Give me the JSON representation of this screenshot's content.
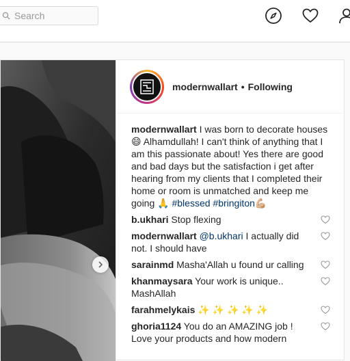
{
  "search": {
    "placeholder": "Search"
  },
  "nav": {
    "explore_icon": "compass-icon",
    "activity_icon": "heart-icon",
    "profile_icon": "person-icon"
  },
  "post": {
    "username": "modernwallart",
    "separator": "•",
    "follow_status": "Following",
    "caption": {
      "username": "modernwallart",
      "text": "I was born to decorate houses 😄 Alhamdullah! I can't think of anything that I am this passionate about! Yes there are good and bad days but the satisfaction i get after hearing from my clients that I completed their home or room is unmatched and keep me going 🙏",
      "tag1": "#blessed",
      "tag2": "#bringiton",
      "tag_emoji": "💪🏼"
    },
    "comments": [
      {
        "username": "b.ukhari",
        "text": "Stop flexing"
      },
      {
        "username": "modernwallart",
        "mention": "@b.ukhari",
        "text": "I actually did not. I should have"
      },
      {
        "username": "sarainmd",
        "text": "Masha'Allah u found ur calling"
      },
      {
        "username": "khanmaysara",
        "text": "Your work is unique.. MashAllah"
      },
      {
        "username": "farahmelykais",
        "text": "✨ ✨ ✨ ✨ ✨"
      },
      {
        "username": "ghoria1124",
        "text": "You do an AMAZING job ! Love your products and how modern"
      }
    ]
  }
}
